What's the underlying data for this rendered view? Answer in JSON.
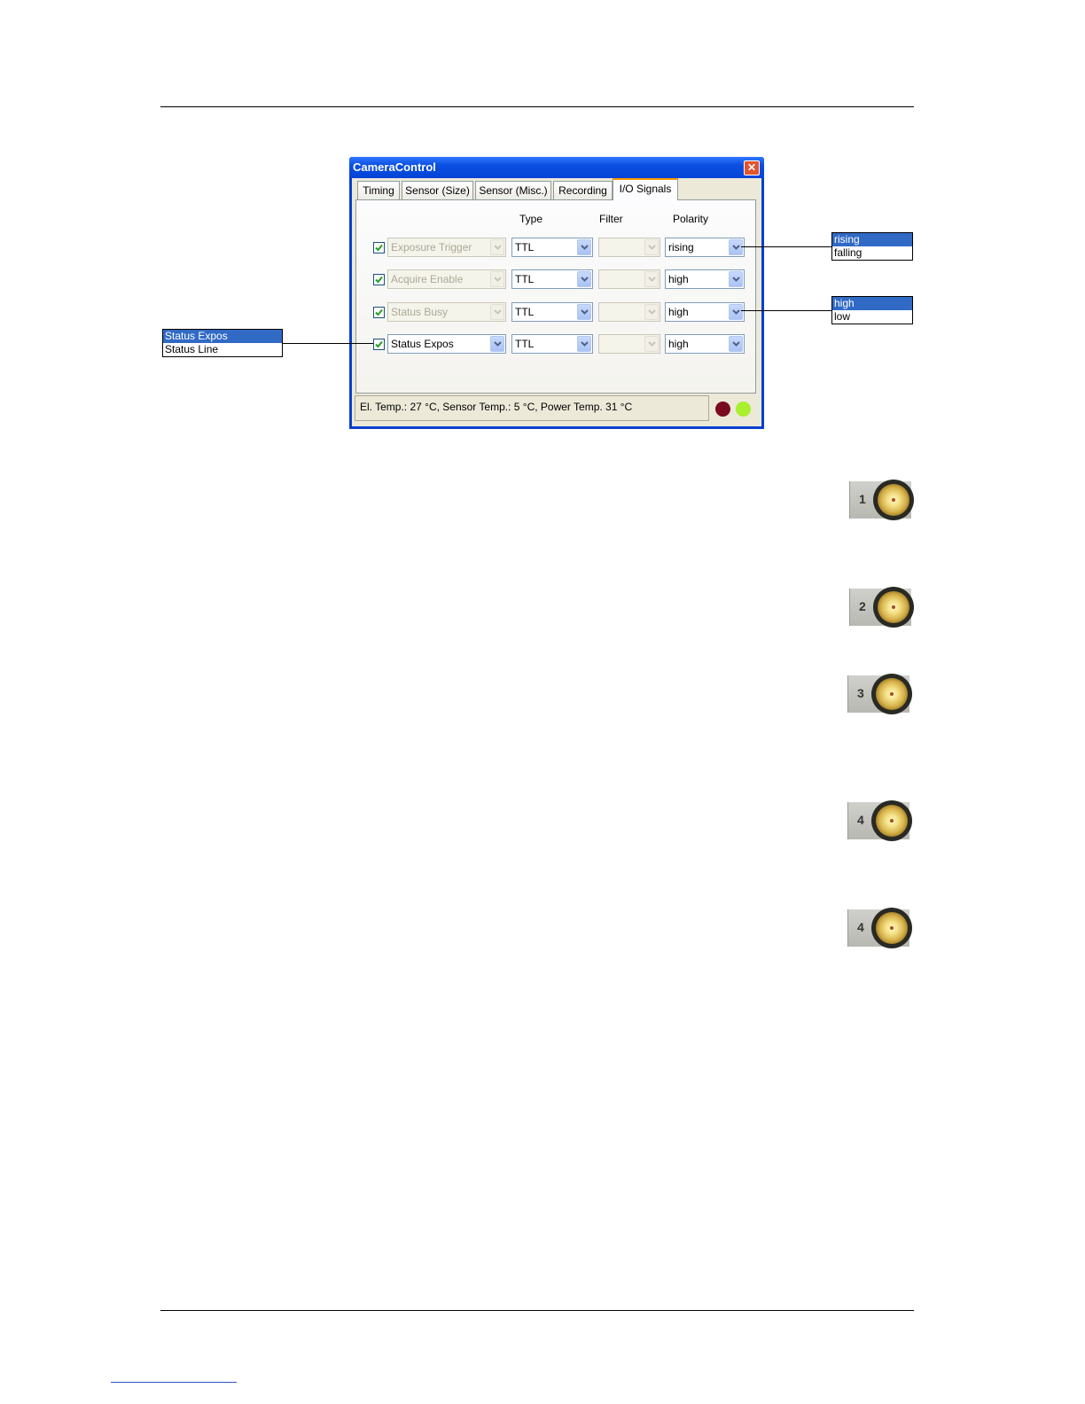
{
  "window": {
    "title": "CameraControl",
    "close_glyph": "✕",
    "tabs": [
      "Timing",
      "Sensor (Size)",
      "Sensor (Misc.)",
      "Recording",
      "I/O Signals"
    ],
    "active_tab": "I/O Signals",
    "columns": {
      "type": "Type",
      "filter": "Filter",
      "polarity": "Polarity"
    },
    "rows": [
      {
        "checked": true,
        "signal": "Exposure Trigger",
        "signal_enabled": false,
        "type": "TTL",
        "filter": "",
        "polarity": "rising"
      },
      {
        "checked": true,
        "signal": "Acquire Enable",
        "signal_enabled": false,
        "type": "TTL",
        "filter": "",
        "polarity": "high"
      },
      {
        "checked": true,
        "signal": "Status Busy",
        "signal_enabled": false,
        "type": "TTL",
        "filter": "",
        "polarity": "high"
      },
      {
        "checked": true,
        "signal": "Status Expos",
        "signal_enabled": true,
        "type": "TTL",
        "filter": "",
        "polarity": "high"
      }
    ],
    "status_text": "El. Temp.: 27 °C, Sensor Temp.: 5 °C, Power Temp. 31 °C",
    "leds": [
      {
        "color": "#7a0b1e"
      },
      {
        "color": "#a8f030"
      }
    ]
  },
  "callouts": {
    "trigger_polarity": [
      "rising",
      "falling"
    ],
    "status_polarity": [
      "high",
      "low"
    ],
    "status_signal": [
      "Status Expos",
      "Status Line"
    ]
  },
  "connectors": [
    "1",
    "2",
    "3",
    "4",
    "4"
  ]
}
